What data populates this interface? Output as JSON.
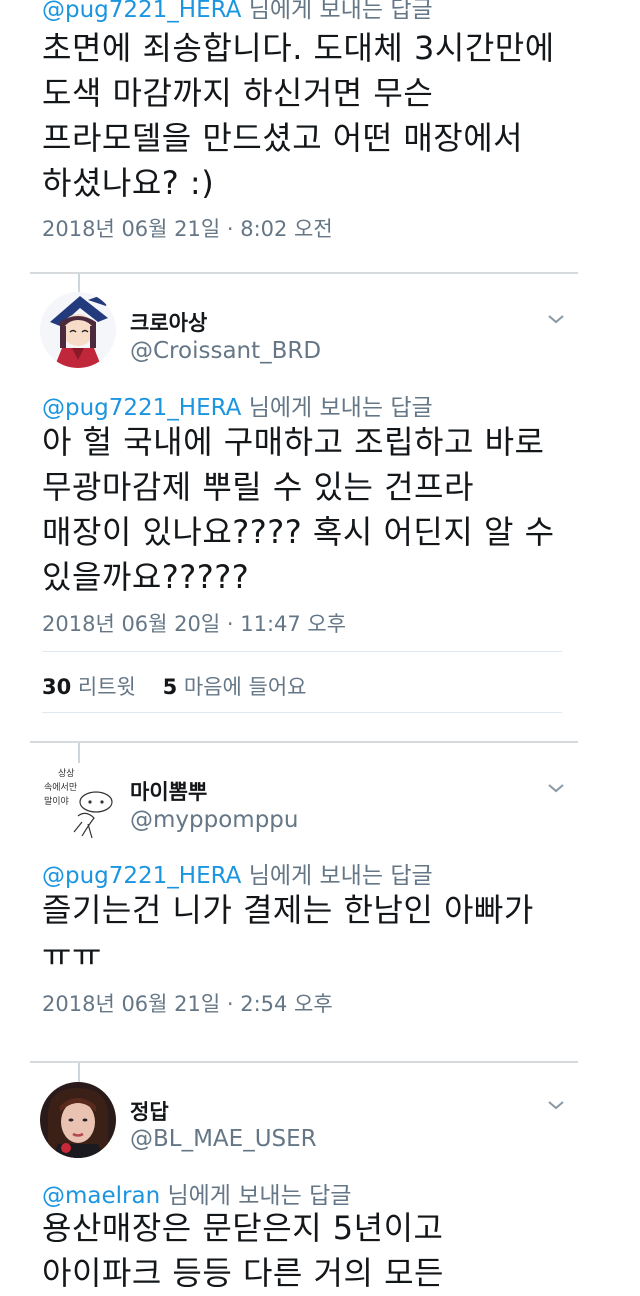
{
  "reply_prefix_suffix": "님에게 보내는 답글",
  "tweets": [
    {
      "reply_to": "@pug7221_HERA",
      "lines": [
        "초면에 죄송합니다. 도대체 3시간만에",
        "도색 마감까지 하신거면 무슨",
        "프라모델을 만드셨고 어떤 매장에서",
        "하셨나요? :)"
      ],
      "timestamp": "2018년 06월 21일 · 8:02 오전"
    },
    {
      "name": "크로아상",
      "handle": "@Croissant_BRD",
      "reply_to": "@pug7221_HERA",
      "lines": [
        "아 헐 국내에 구매하고 조립하고 바로",
        "무광마감제 뿌릴 수 있는 건프라",
        "매장이 있나요???? 혹시 어딘지 알 수",
        "있을까요?????"
      ],
      "timestamp": "2018년 06월 20일 · 11:47 오후",
      "retweets": "30",
      "retweets_label": "리트윗",
      "likes": "5",
      "likes_label": "마음에 들어요"
    },
    {
      "name": "마이뽐뿌",
      "handle": "@myppomppu",
      "avatar_text": [
        "상상",
        "속에서만",
        "말이야"
      ],
      "reply_to": "@pug7221_HERA",
      "lines": [
        "즐기는건 니가 결제는 한남인 아빠가",
        "ㅠㅠ"
      ],
      "timestamp": "2018년 06월 21일 · 2:54 오후"
    },
    {
      "name": "정답",
      "handle": "@BL_MAE_USER",
      "reply_to": "@maelran",
      "lines": [
        "용산매장은 문닫은지 5년이고",
        "아이파크 등등 다른 거의 모든"
      ]
    }
  ]
}
